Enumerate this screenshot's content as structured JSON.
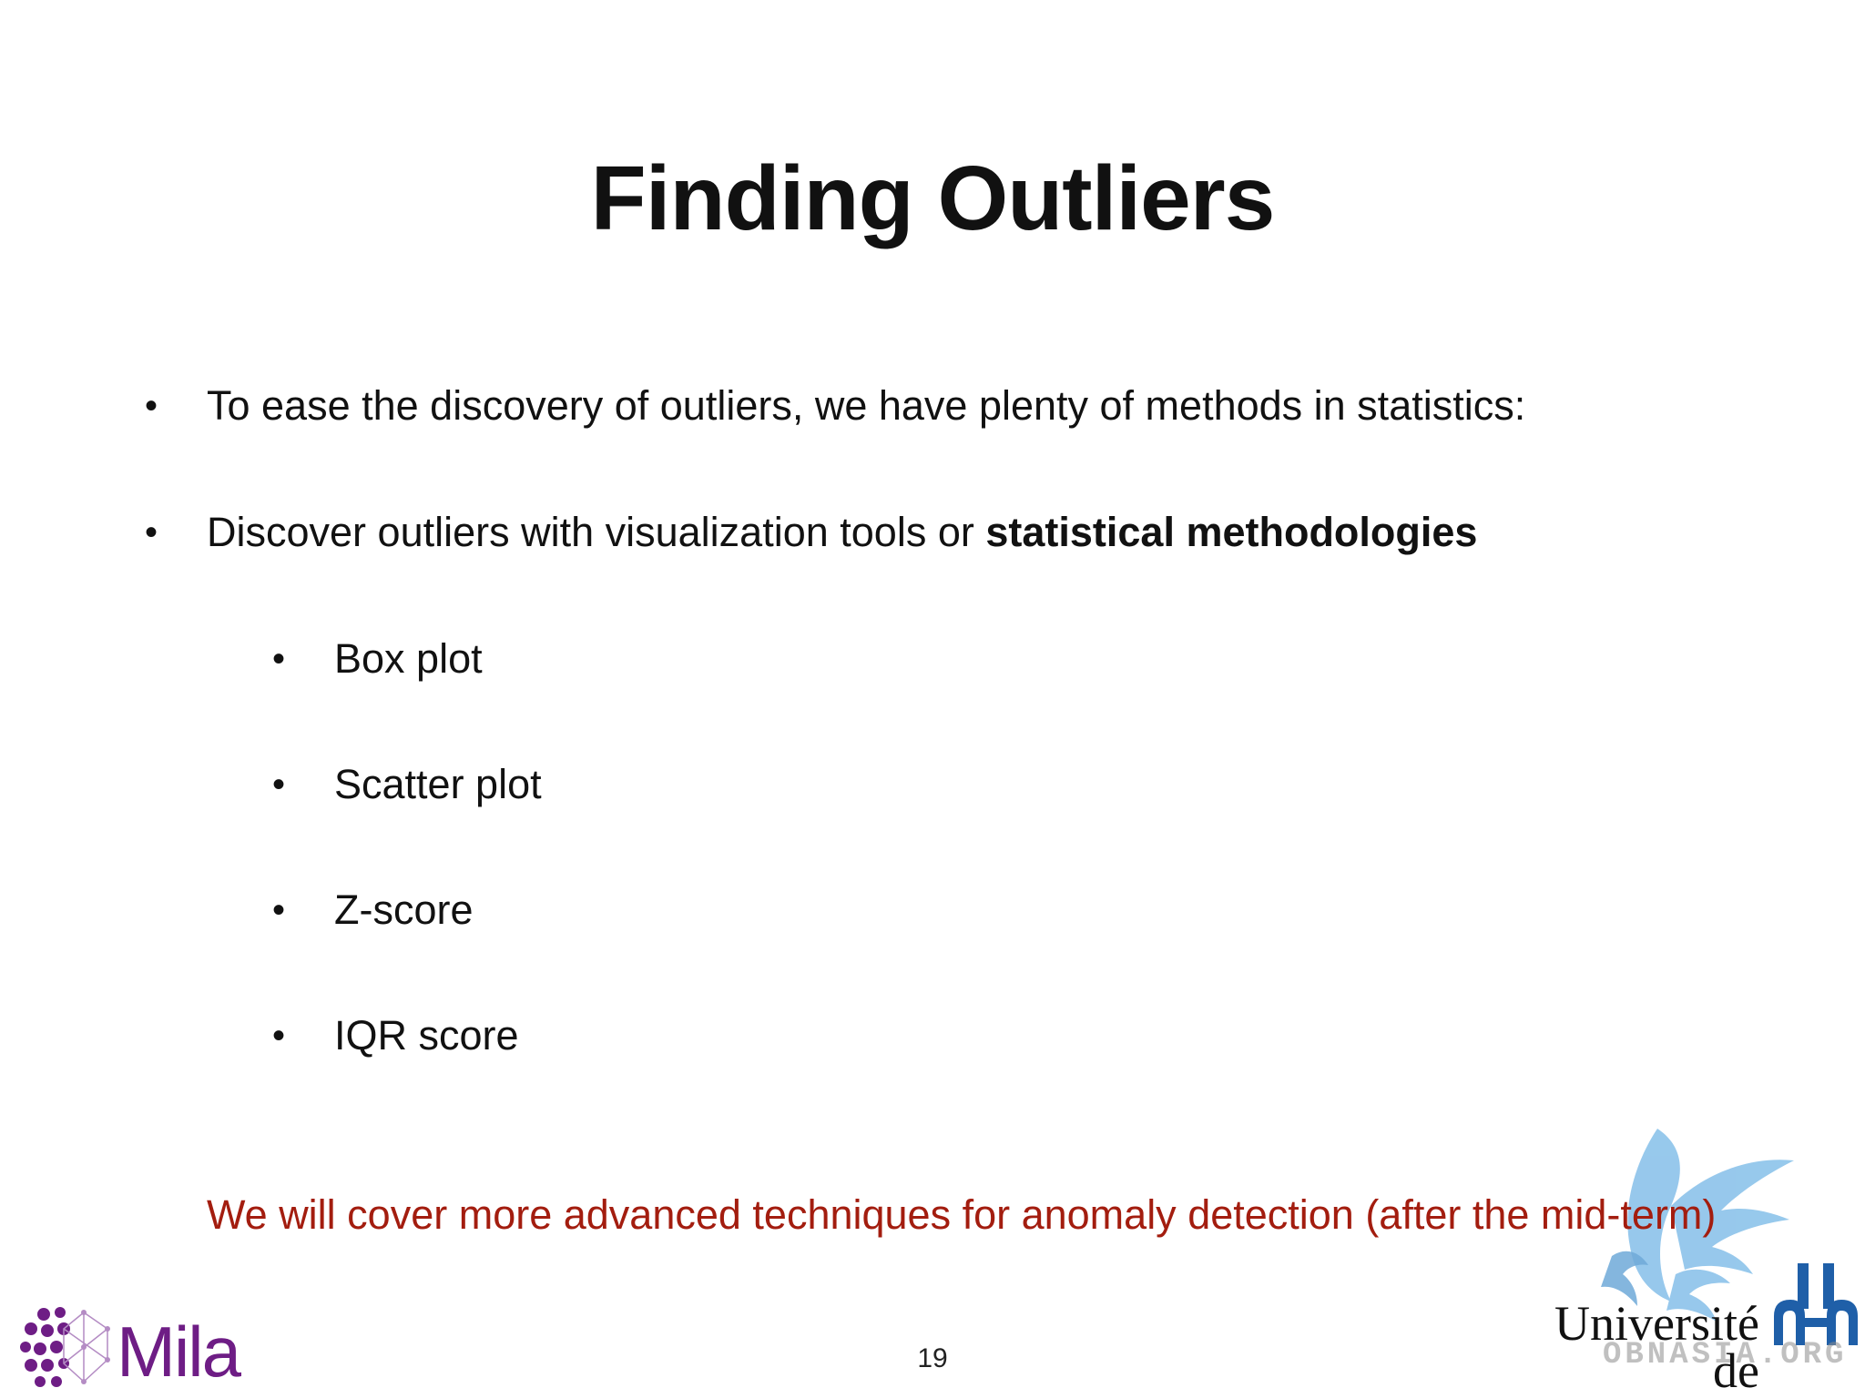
{
  "title": "Finding Outliers",
  "bullets": [
    {
      "text": "To ease the discovery of outliers, we have plenty of methods in statistics:"
    },
    {
      "text": "Discover outliers with visualization tools or ",
      "bold": "statistical methodologies"
    }
  ],
  "sub_bullets": [
    "Box plot",
    "Scatter plot",
    "Z-score",
    "IQR score"
  ],
  "note": "We will cover more advanced techniques for anomaly detection (after the mid-term)",
  "page_number": "19",
  "logos": {
    "mila": {
      "text": "Mila",
      "color": "#6e1d85"
    },
    "udem": {
      "line1": "Université",
      "line2": "de Montréal",
      "bird_color": "#7fb8e6",
      "mark_color": "#1f5fa8"
    },
    "watermark": "OBNASIA.ORG"
  },
  "colors": {
    "text": "#111111",
    "note": "#a31d0f",
    "background": "#ffffff"
  }
}
